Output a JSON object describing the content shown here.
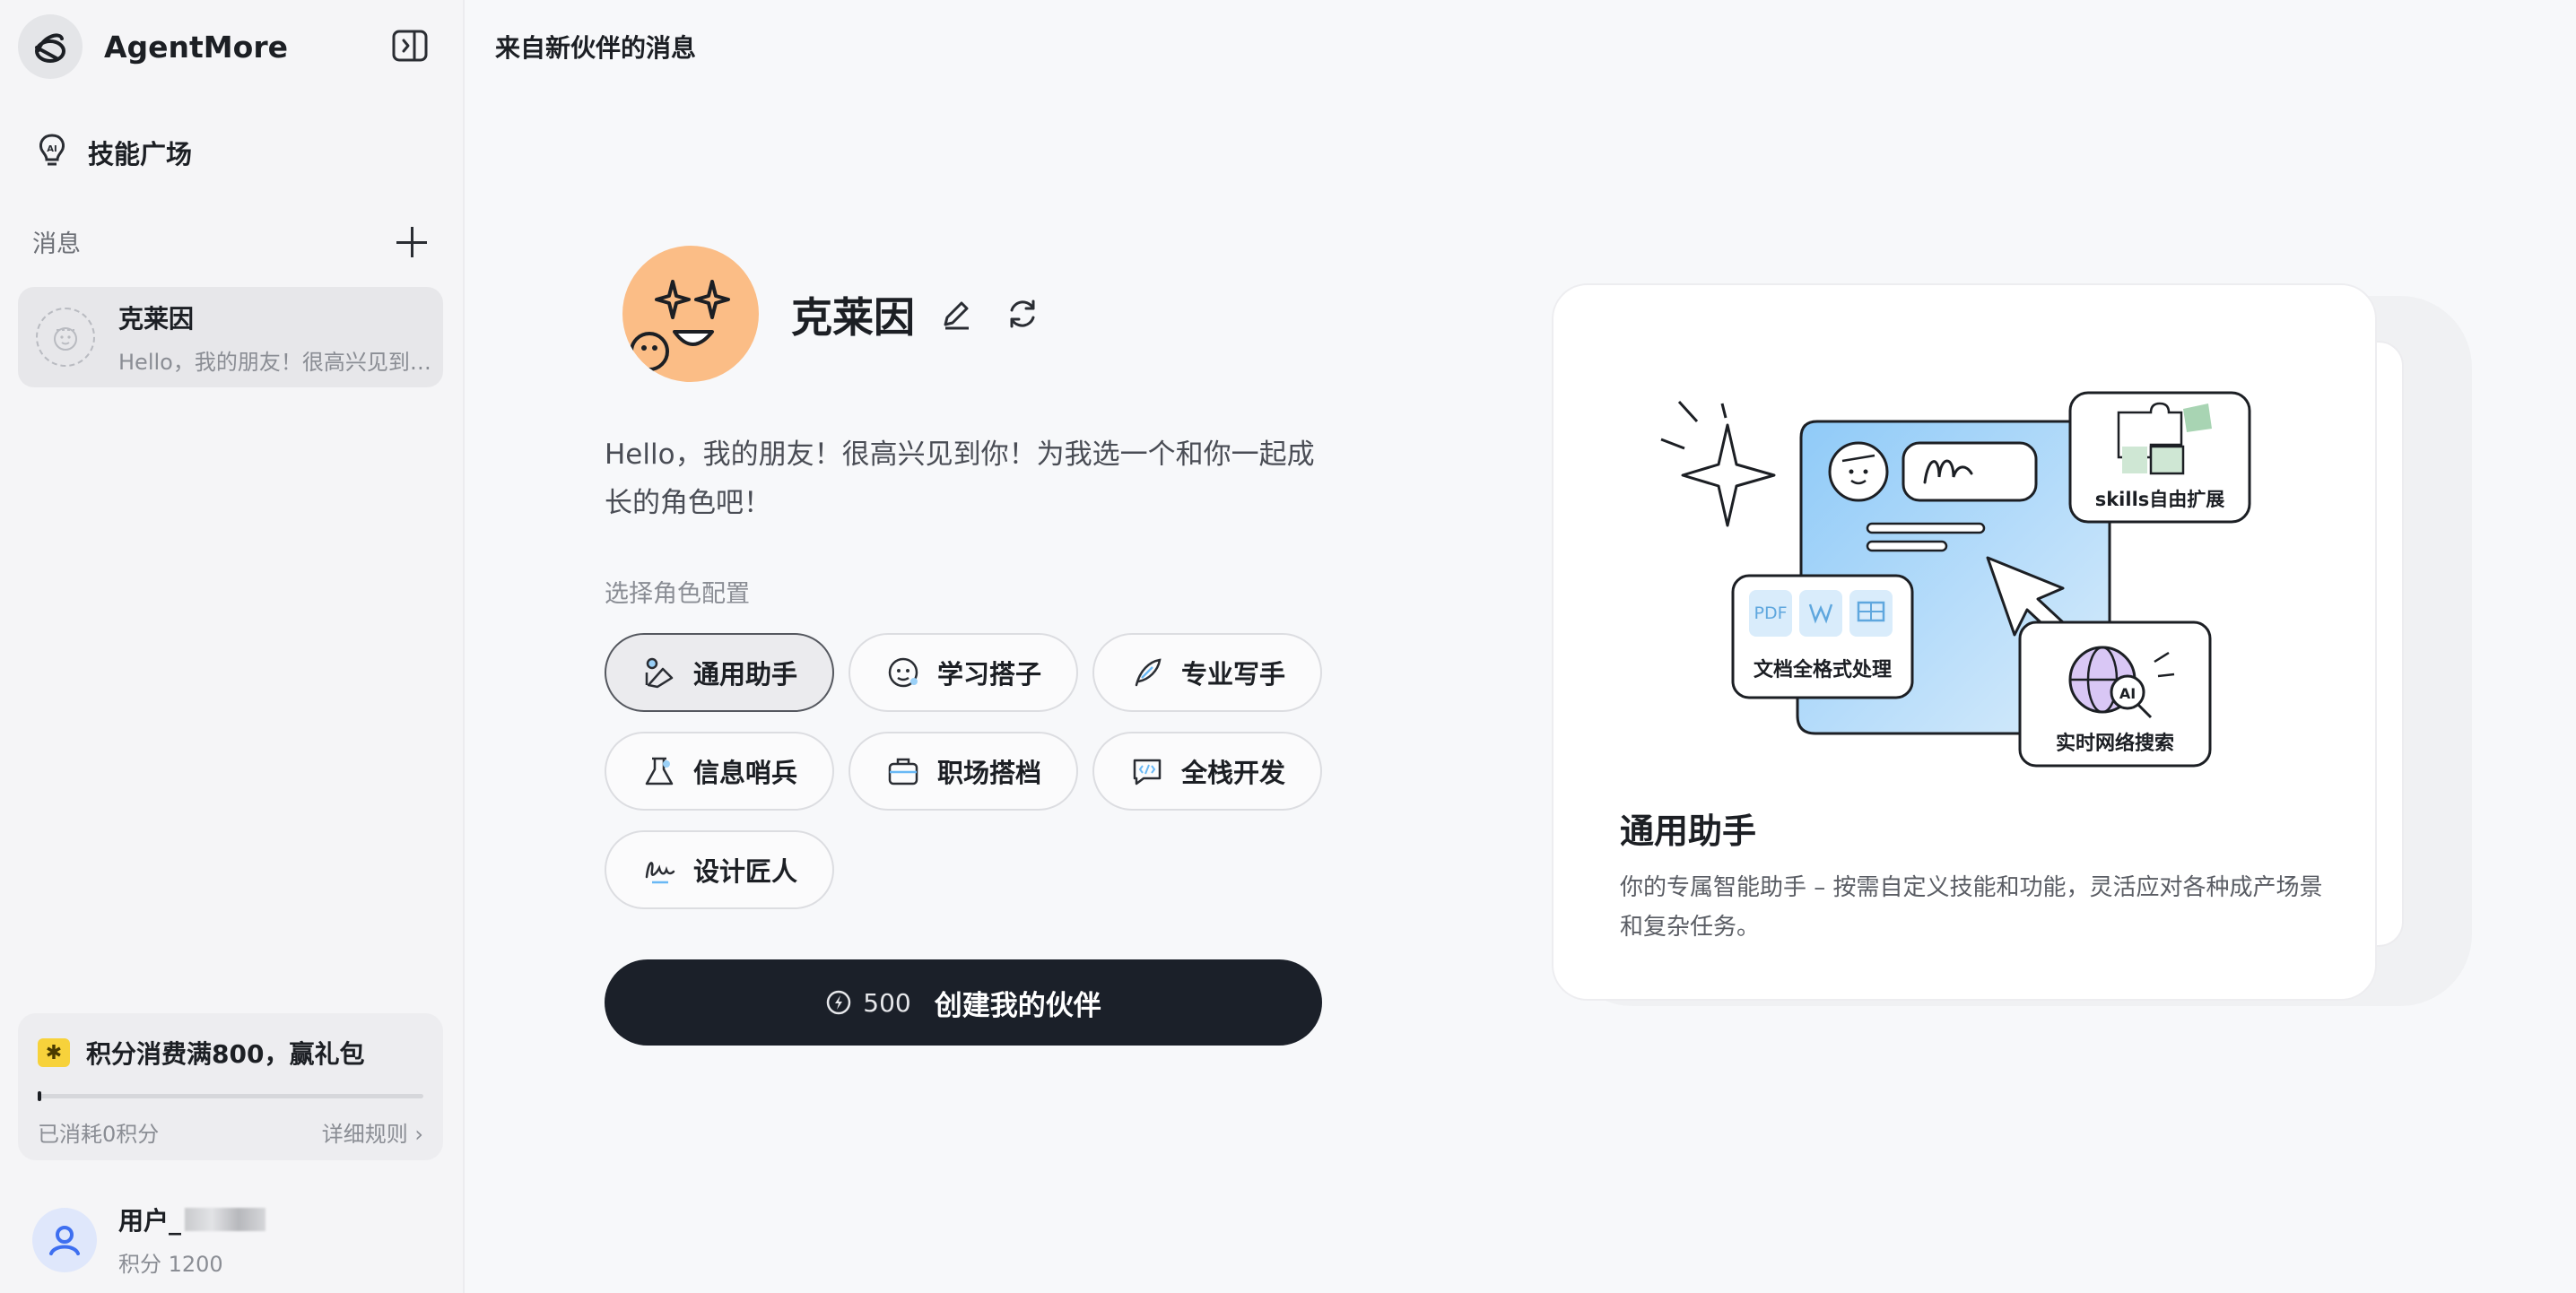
{
  "app": {
    "name": "AgentMore"
  },
  "sidebar": {
    "skill_plaza": "技能广场",
    "messages_label": "消息",
    "conversations": [
      {
        "name": "克莱因",
        "preview": "Hello，我的朋友！很高兴见到你！为我选一个和你一起成长的角色吧！"
      }
    ],
    "promo": {
      "title": "积分消费满800，赢礼包",
      "consumed": "已消耗0积分",
      "rules": "详细规则",
      "progress": 0
    },
    "user": {
      "name": "用户_",
      "points": "积分 1200"
    }
  },
  "main": {
    "header_title": "来自新伙伴的消息",
    "agent": {
      "name": "克莱因",
      "greeting": "Hello，我的朋友！很高兴见到你！为我选一个和你一起成长的角色吧！"
    },
    "choose_label": "选择角色配置",
    "roles": [
      {
        "label": "通用助手",
        "icon": "robot-icon",
        "selected": true
      },
      {
        "label": "学习搭子",
        "icon": "study-icon",
        "selected": false
      },
      {
        "label": "专业写手",
        "icon": "feather-icon",
        "selected": false
      },
      {
        "label": "信息哨兵",
        "icon": "flask-icon",
        "selected": false
      },
      {
        "label": "职场搭档",
        "icon": "briefcase-icon",
        "selected": false
      },
      {
        "label": "全栈开发",
        "icon": "code-icon",
        "selected": false
      },
      {
        "label": "设计匠人",
        "icon": "signature-icon",
        "selected": false
      }
    ],
    "create_button": {
      "cost": "500",
      "label": "创建我的伙伴"
    }
  },
  "card": {
    "badges": {
      "skills": "skills自由扩展",
      "docs": "文档全格式处理",
      "search": "实时网络搜索",
      "pdf": "PDF",
      "ai": "AI"
    },
    "title": "通用助手",
    "description": "你的专属智能助手 – 按需自定义技能和功能，灵活应对各种成产场景和复杂任务。"
  },
  "colors": {
    "primary_button": "#1b2029",
    "avatar_bg": "#fbbd86",
    "accent_blue": "#69b8f5",
    "gift_yellow": "#f7d23b"
  }
}
